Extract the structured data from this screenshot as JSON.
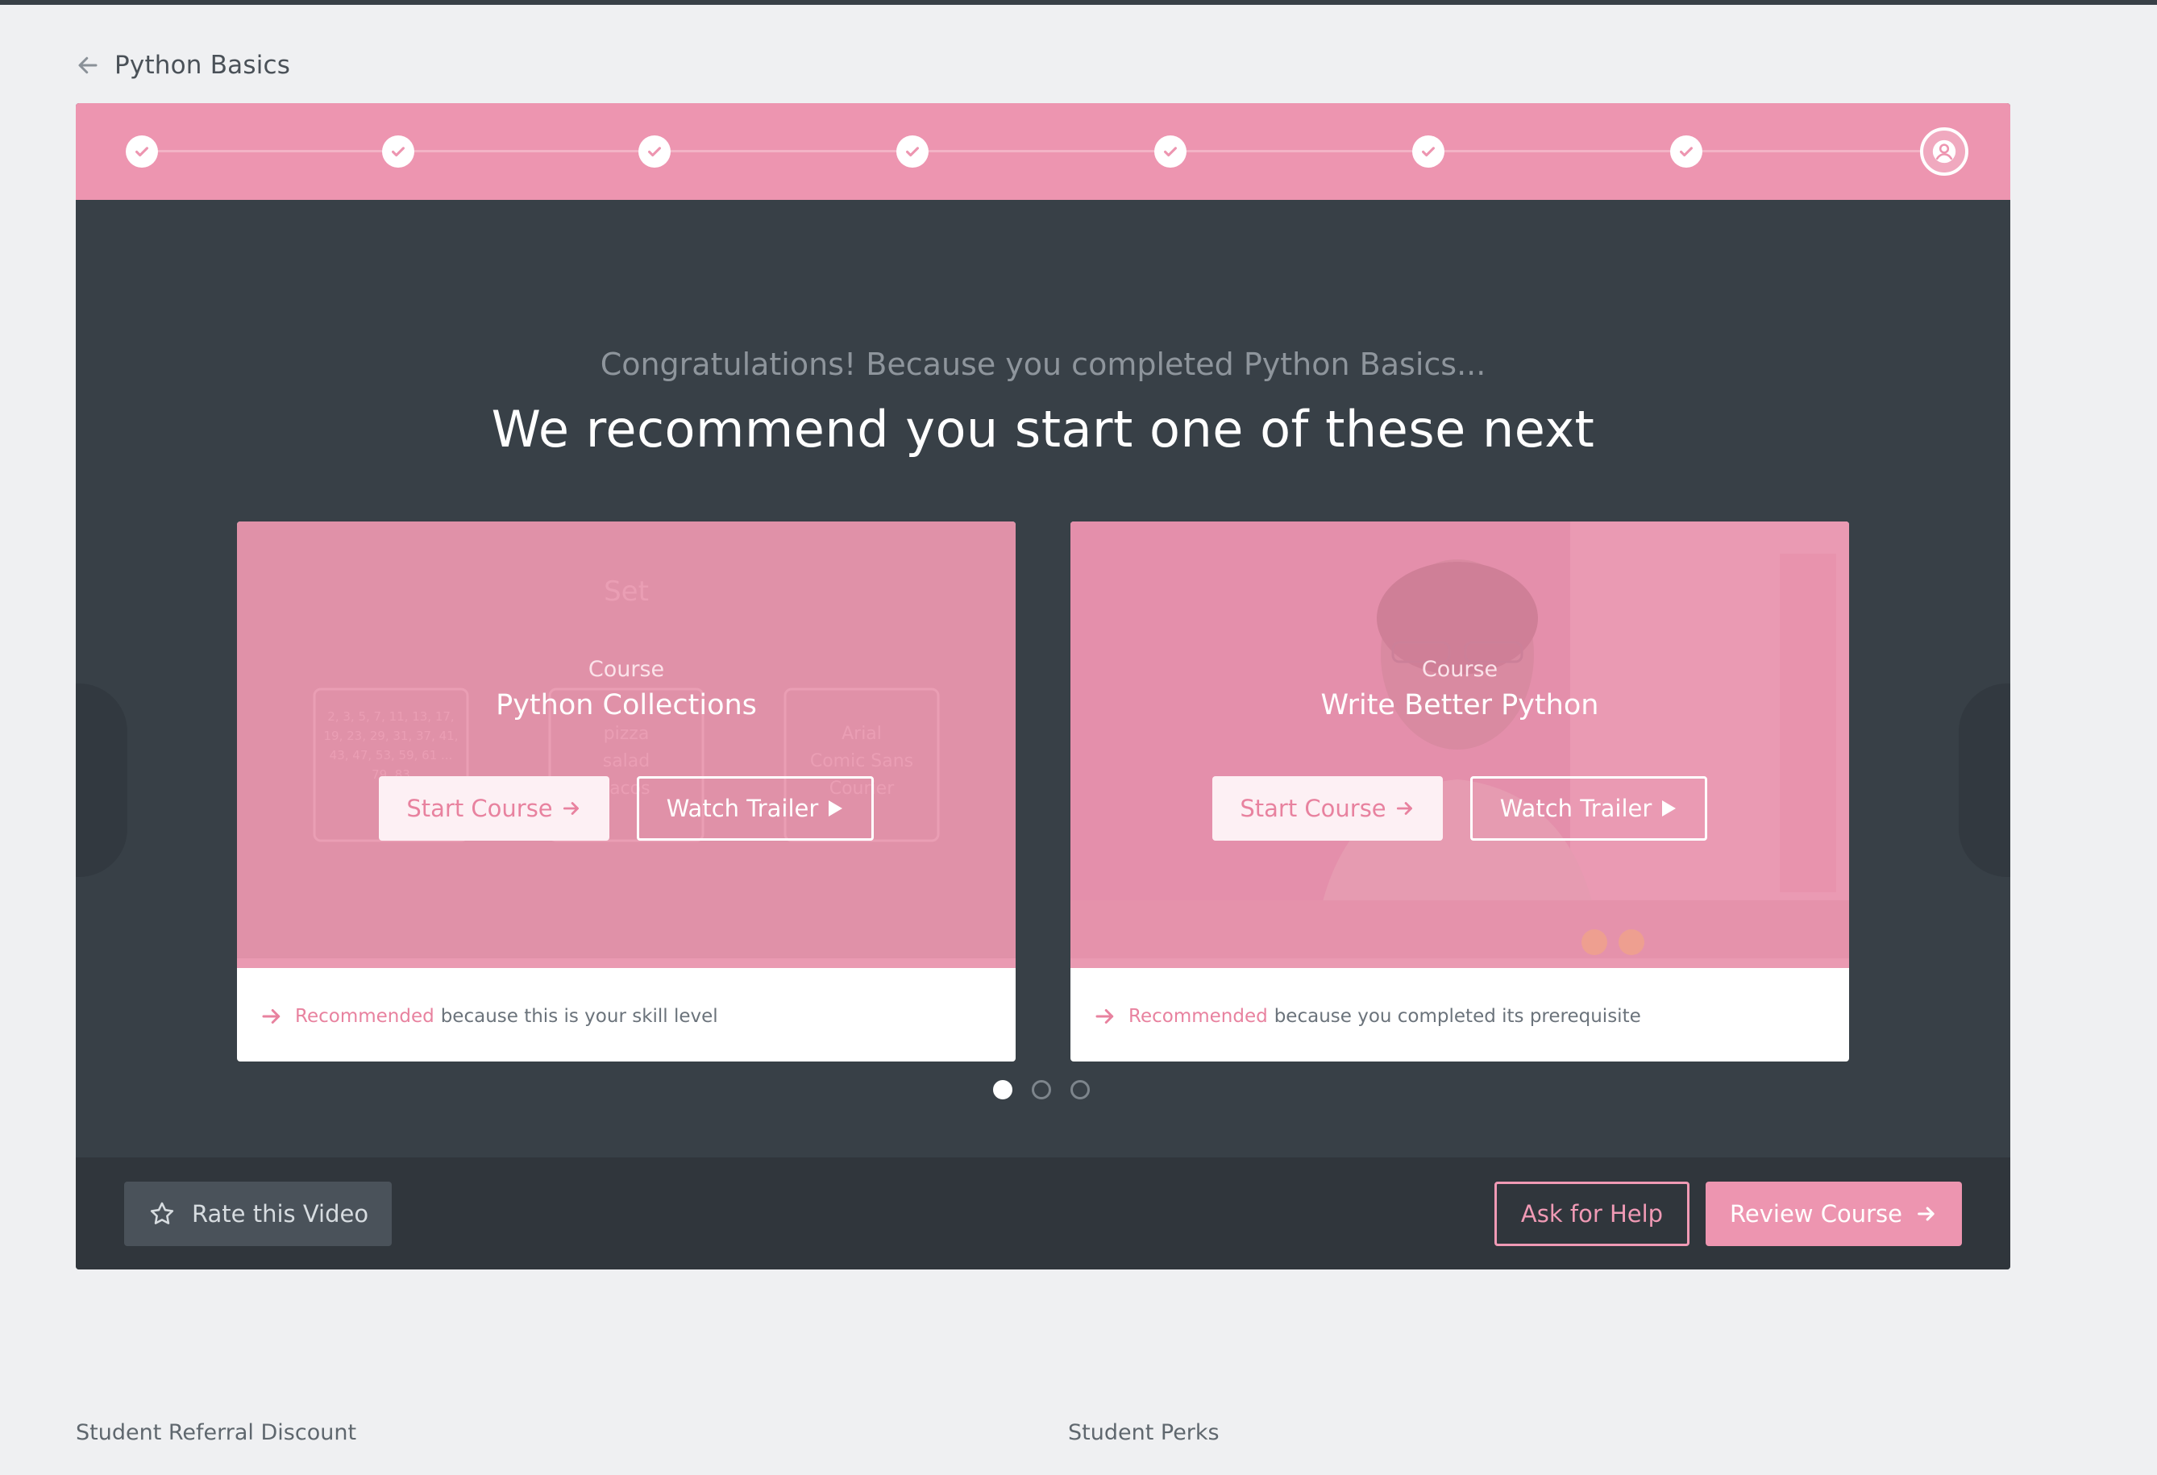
{
  "breadcrumb": {
    "back_icon": "arrow-left-icon",
    "title": "Python Basics"
  },
  "progress": {
    "steps_completed": 7,
    "steps_total": 8,
    "completed_icon": "check-icon",
    "final_icon": "user-icon"
  },
  "intro": {
    "eyebrow": "Congratulations! Because you completed Python Basics...",
    "headline": "We recommend you start one of these next"
  },
  "cards": [
    {
      "type": "Course",
      "title": "Python Collections",
      "start_label": "Start Course",
      "trailer_label": "Watch Trailer",
      "reason_tag": "Recommended",
      "reason_text": "because this is your skill level",
      "art": {
        "heading": "Set",
        "box1": "2, 3, 5, 7, 11, 13, 17, 19, 23, 29, 31, 37, 41, 43, 47, 53, 59, 61 ... 79, 83",
        "box2": [
          "pizza",
          "salad",
          "tacos"
        ],
        "box3": [
          "Arial",
          "Comic Sans",
          "Courier"
        ]
      }
    },
    {
      "type": "Course",
      "title": "Write Better Python",
      "start_label": "Start Course",
      "trailer_label": "Watch Trailer",
      "reason_tag": "Recommended",
      "reason_text": "because you completed its prerequisite"
    }
  ],
  "pagination": {
    "total": 3,
    "active": 1
  },
  "footer": {
    "rate_label": "Rate this Video",
    "rate_icon": "star-icon",
    "help_label": "Ask for Help",
    "review_label": "Review Course",
    "review_icon": "arrow-right-icon"
  },
  "bottom_links": [
    "Student Referral Discount",
    "Student Perks"
  ],
  "colors": {
    "accent_pink": "#ed95b0",
    "panel_dark": "#384047",
    "footer_dark": "#30363c",
    "page_bg": "#eff0f2"
  }
}
